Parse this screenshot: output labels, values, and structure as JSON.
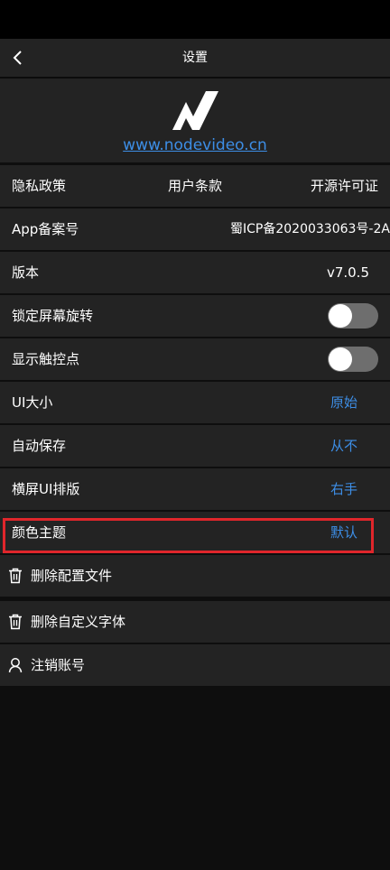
{
  "nav": {
    "title": "设置",
    "back_icon": "chevron-left-icon"
  },
  "header": {
    "logo_icon": "nodevideo-logo",
    "website": "www.nodevideo.cn"
  },
  "links": {
    "privacy": "隐私政策",
    "terms": "用户条款",
    "open_source": "开源许可证"
  },
  "settings": {
    "filing_label": "App备案号",
    "filing_value": "蜀ICP备2020033063号-2A",
    "version_label": "版本",
    "version_value": "v7.0.5",
    "lock_rotation_label": "锁定屏幕旋转",
    "lock_rotation_on": false,
    "show_touches_label": "显示触控点",
    "show_touches_on": false,
    "ui_size_label": "UI大小",
    "ui_size_value": "原始",
    "autosave_label": "自动保存",
    "autosave_value": "从不",
    "landscape_label": "横屏UI排版",
    "landscape_value": "右手",
    "theme_label": "颜色主题",
    "theme_value": "默认"
  },
  "actions": {
    "delete_config": "删除配置文件",
    "delete_fonts": "删除自定义字体",
    "delete_account": "注销账号"
  },
  "colors": {
    "accent": "#3d8ee6",
    "highlight": "#e0262b",
    "row_bg": "#232323",
    "page_bg": "#0e0e0e"
  }
}
